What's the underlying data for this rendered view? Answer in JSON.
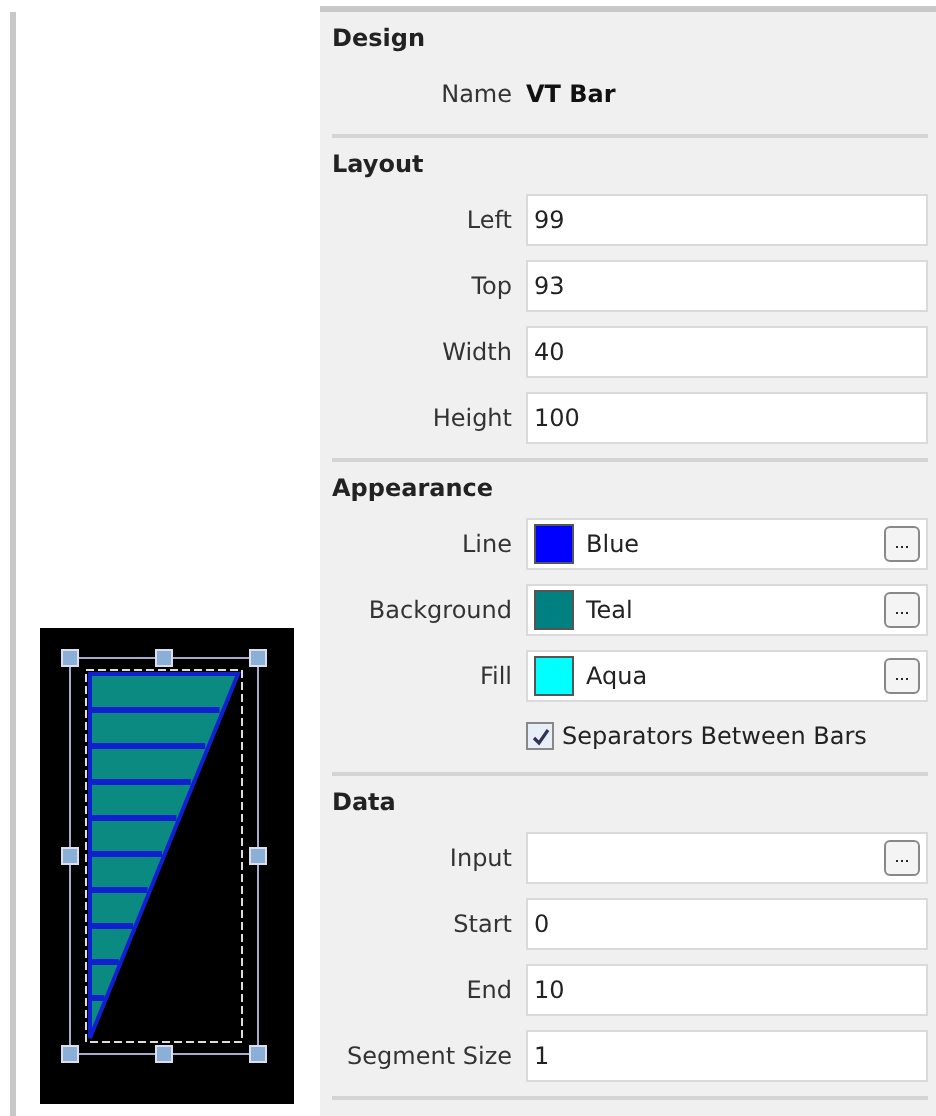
{
  "sections": [
    {
      "title": "Design",
      "rows": [
        {
          "kind": "text",
          "label": "Name",
          "value": "VT Bar"
        }
      ]
    },
    {
      "title": "Layout",
      "rows": [
        {
          "kind": "field",
          "label": "Left",
          "value": "99"
        },
        {
          "kind": "field",
          "label": "Top",
          "value": "93"
        },
        {
          "kind": "field",
          "label": "Width",
          "value": "40"
        },
        {
          "kind": "field",
          "label": "Height",
          "value": "100"
        }
      ]
    },
    {
      "title": "Appearance",
      "rows": [
        {
          "kind": "color",
          "label": "Line",
          "value": "Blue",
          "color": "#0000ff",
          "button": "..."
        },
        {
          "kind": "color",
          "label": "Background",
          "value": "Teal",
          "color": "#008080",
          "button": "..."
        },
        {
          "kind": "color",
          "label": "Fill",
          "value": "Aqua",
          "color": "#00ffff",
          "button": "..."
        },
        {
          "kind": "checkbox",
          "label": "Separators Between Bars",
          "checked": true
        }
      ]
    },
    {
      "title": "Data",
      "rows": [
        {
          "kind": "picker",
          "label": "Input",
          "value": "",
          "button": "..."
        },
        {
          "kind": "field",
          "label": "Start",
          "value": "0"
        },
        {
          "kind": "field",
          "label": "End",
          "value": "10"
        },
        {
          "kind": "field",
          "label": "Segment Size",
          "value": "1"
        }
      ]
    }
  ]
}
